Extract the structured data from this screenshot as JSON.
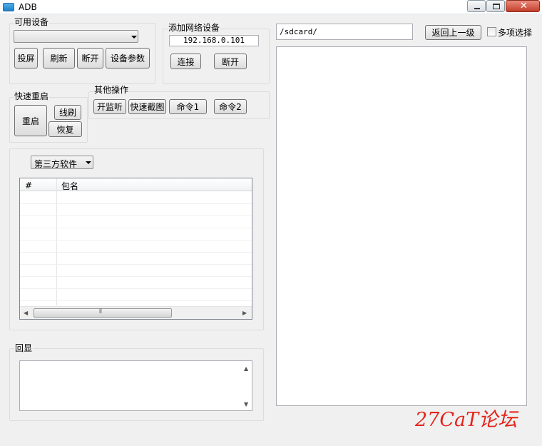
{
  "window": {
    "title": "ADB"
  },
  "devices": {
    "group_label": "可用设备",
    "selected": "",
    "buttons": {
      "screen": "投屏",
      "refresh": "刷新",
      "disconnect": "断开",
      "params": "设备参数"
    }
  },
  "network": {
    "group_label": "添加网络设备",
    "ip": "192.168.0.101",
    "buttons": {
      "connect": "连接",
      "disconnect": "断开"
    }
  },
  "reboot": {
    "group_label": "快速重启",
    "buttons": {
      "reboot": "重启",
      "flash": "线刷",
      "recovery": "恢复"
    }
  },
  "other": {
    "group_label": "其他操作",
    "buttons": {
      "listen": "开监听",
      "screenshot": "快速截图",
      "cmd1": "命令1",
      "cmd2": "命令2"
    }
  },
  "apps": {
    "filter_selected": "第三方软件",
    "columns": [
      "#",
      "包名"
    ],
    "rows": []
  },
  "echo": {
    "group_label": "回显",
    "text": ""
  },
  "files": {
    "path": "/sdcard/",
    "back_label": "返回上一级",
    "multi_select_label": "多项选择",
    "multi_select_checked": false
  },
  "watermark": "27CaT论坛"
}
